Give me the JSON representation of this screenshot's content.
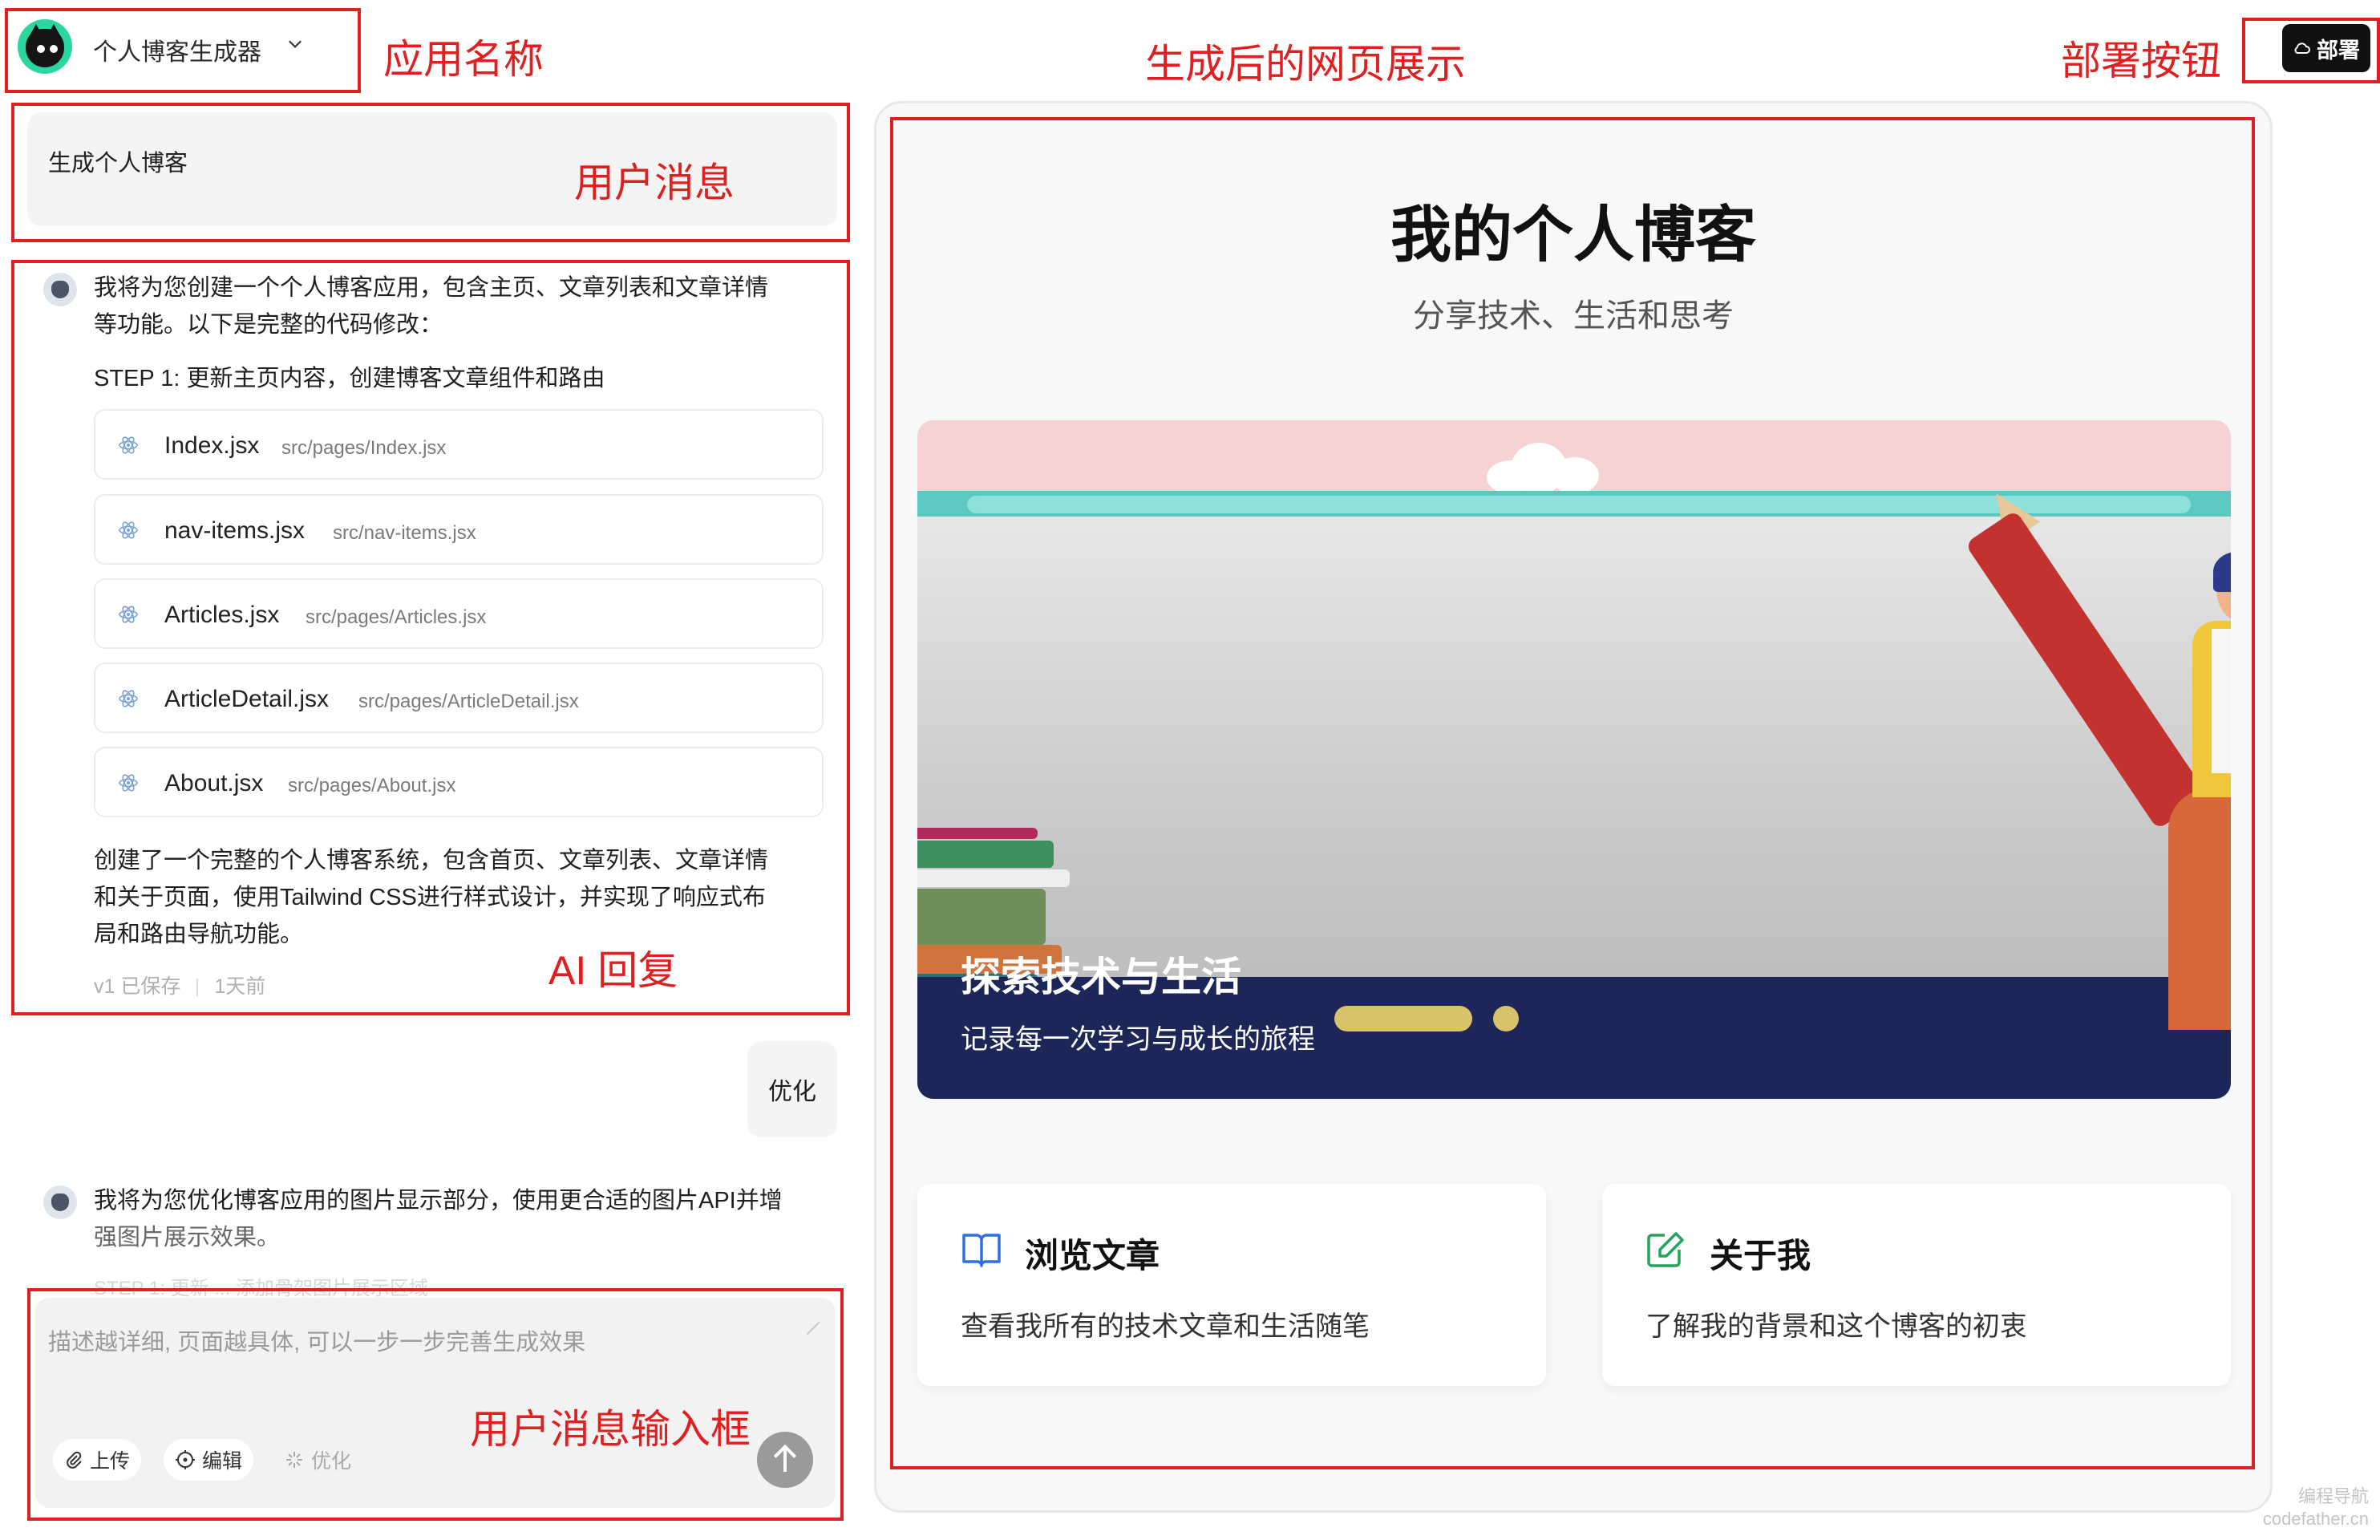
{
  "header": {
    "app_name": "个人博客生成器",
    "deploy_label": "部署"
  },
  "annotations": {
    "app_name": "应用名称",
    "user_message": "用户消息",
    "preview": "生成后的网页展示",
    "deploy_button": "部署按钮",
    "ai_reply": "AI 回复",
    "input_box": "用户消息输入框"
  },
  "chat": {
    "user_message_1": "生成个人博客",
    "ai_reply_1_line1": "我将为您创建一个个人博客应用，包含主页、文章列表和文章详情",
    "ai_reply_1_line2": "等功能。以下是完整的代码修改：",
    "step_1": "STEP 1: 更新主页内容，创建博客文章组件和路由",
    "files": [
      {
        "name": "Index.jsx",
        "path": "src/pages/Index.jsx"
      },
      {
        "name": "nav-items.jsx",
        "path": "src/nav-items.jsx"
      },
      {
        "name": "Articles.jsx",
        "path": "src/pages/Articles.jsx"
      },
      {
        "name": "ArticleDetail.jsx",
        "path": "src/pages/ArticleDetail.jsx"
      },
      {
        "name": "About.jsx",
        "path": "src/pages/About.jsx"
      }
    ],
    "summary_line1": "创建了一个完整的个人博客系统，包含首页、文章列表、文章详情",
    "summary_line2": "和关于页面，使用Tailwind CSS进行样式设计，并实现了响应式布",
    "summary_line3": "局和路由导航功能。",
    "meta_version": "v1 已保存",
    "meta_time": "1天前",
    "user_message_2": "优化",
    "ai_reply_2_line1": "我将为您优化博客应用的图片显示部分，使用更合适的图片API并增",
    "ai_reply_2_line2": "强图片展示效果。",
    "ai_reply_2_faded": "STEP 1: 更新 ... 添加骨架图片展示区域"
  },
  "input": {
    "placeholder": "描述越详细, 页面越具体, 可以一步一步完善生成效果",
    "upload_label": "上传",
    "edit_label": "编辑",
    "optimize_label": "优化"
  },
  "preview": {
    "title": "我的个人博客",
    "subtitle": "分享技术、生活和思考",
    "hero_title": "探索技术与生活",
    "hero_subtitle": "记录每一次学习与成长的旅程",
    "cards": [
      {
        "title": "浏览文章",
        "desc": "查看我所有的技术文章和生活随笔",
        "icon": "book-open-icon",
        "color": "#2f6fe0"
      },
      {
        "title": "关于我",
        "desc": "了解我的背景和这个博客的初衷",
        "icon": "edit-icon",
        "color": "#22a55a"
      }
    ]
  },
  "watermark": {
    "line1": "编程导航",
    "line2": "codefather.cn"
  },
  "colors": {
    "annotation_red": "#e02020",
    "logo_green": "#2cd6a0",
    "deploy_bg": "#111111"
  }
}
